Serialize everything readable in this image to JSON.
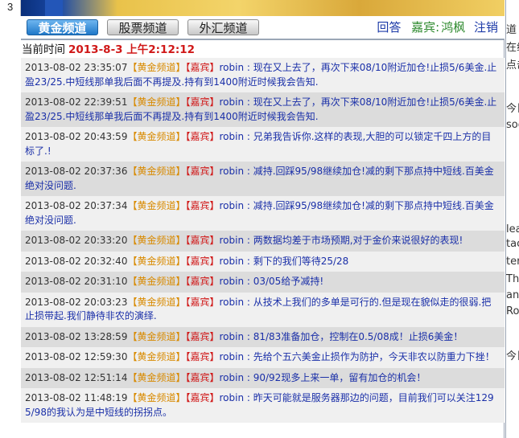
{
  "header": {
    "tabs": [
      {
        "label": "黄金频道",
        "active": true
      },
      {
        "label": "股票频道",
        "active": false
      },
      {
        "label": "外汇频道",
        "active": false
      }
    ],
    "reply_label": "回答",
    "guest_label": "嘉宾:",
    "guest_name": "鸿枫",
    "logout_label": "注销"
  },
  "time_row": {
    "label": "当前时间",
    "value": "2013-8-3 上午2:12:12"
  },
  "messages": [
    {
      "time": "2013-08-02 23:35:07",
      "channel": "【黄金频道】",
      "guest_tag": "【嘉宾】",
      "author": "robin",
      "text": " : 现在又上去了，再次下来08/10附近加仓!止损5/6美金.止盈23/25.中短线那单我后面不再提及.持有到1400附近时候我会告知."
    },
    {
      "time": "2013-08-02 22:39:51",
      "channel": "【黄金频道】",
      "guest_tag": "【嘉宾】",
      "author": "robin",
      "text": " : 现在又上去了，再次下来08/10附近加仓!止损5/6美金.止盈23/25.中短线那单我后面不再提及.持有到1400附近时候我会告知."
    },
    {
      "time": "2013-08-02 20:43:59",
      "channel": "【黄金频道】",
      "guest_tag": "【嘉宾】",
      "author": "robin",
      "text": " : 兄弟我告诉你.这样的表现,大胆的可以锁定千四上方的目标了.!"
    },
    {
      "time": "2013-08-02 20:37:36",
      "channel": "【黄金频道】",
      "guest_tag": "【嘉宾】",
      "author": "robin",
      "text": " : 减持.回踩95/98继续加仓!减的剩下那点持中短线.百美金绝对没问题."
    },
    {
      "time": "2013-08-02 20:37:34",
      "channel": "【黄金频道】",
      "guest_tag": "【嘉宾】",
      "author": "robin",
      "text": " : 减持.回踩95/98继续加仓!减的剩下那点持中短线.百美金绝对没问题."
    },
    {
      "time": "2013-08-02 20:33:20",
      "channel": "【黄金频道】",
      "guest_tag": "【嘉宾】",
      "author": "robin",
      "text": " : 两数据均差于市场预期,对于金价来说很好的表现!"
    },
    {
      "time": "2013-08-02 20:32:40",
      "channel": "【黄金频道】",
      "guest_tag": "【嘉宾】",
      "author": "robin",
      "text": " : 剩下的我们等待25/28"
    },
    {
      "time": "2013-08-02 20:31:10",
      "channel": "【黄金频道】",
      "guest_tag": "【嘉宾】",
      "author": "robin",
      "text": " : 03/05给予减持!"
    },
    {
      "time": "2013-08-02 20:03:23",
      "channel": "【黄金频道】",
      "guest_tag": "【嘉宾】",
      "author": "robin",
      "text": " : 从技术上我们的多单是可行的.但是现在貌似走的很弱.把止损带起.我们静待非农的演绎."
    },
    {
      "time": "2013-08-02 13:28:59",
      "channel": "【黄金频道】",
      "guest_tag": "【嘉宾】",
      "author": "robin",
      "text": " : 81/83准备加仓，控制在0.5/08成！止损6美金！"
    },
    {
      "time": "2013-08-02 12:59:30",
      "channel": "【黄金频道】",
      "guest_tag": "【嘉宾】",
      "author": "robin",
      "text": " : 先给个五六美金止损作为防护，今天非农以防重力下挫！"
    },
    {
      "time": "2013-08-02 12:51:14",
      "channel": "【黄金频道】",
      "guest_tag": "【嘉宾】",
      "author": "robin",
      "text": " : 90/92现多上来一单，留有加仓的机会！"
    },
    {
      "time": "2013-08-02 11:48:19",
      "channel": "【黄金频道】",
      "guest_tag": "【嘉宾】",
      "author": "robin",
      "text": " : 昨天可能就是服务器那边的问题，目前我们可以关注1295/98的我认为是中短线的拐拐点。"
    }
  ],
  "side_fragments": [
    "道",
    "在线",
    "点击",
    "今日",
    "soc",
    "lea",
    "tac",
    "tere",
    "The",
    "ant",
    "Ro",
    "今日"
  ]
}
